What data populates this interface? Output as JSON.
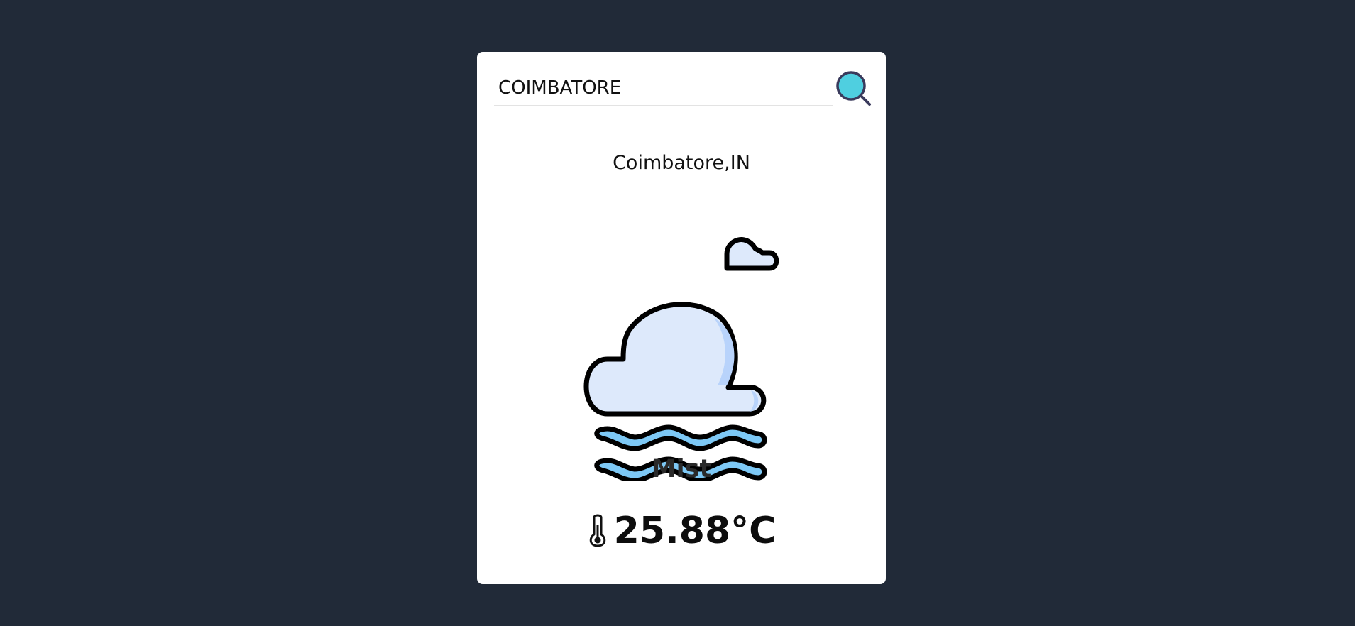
{
  "search": {
    "value": "COIMBATORE",
    "button_icon": "search-icon"
  },
  "weather": {
    "location": "Coimbatore,IN",
    "condition": "Mist",
    "condition_icon": "mist-cloud-icon",
    "temperature": "25.88°C",
    "temperature_icon": "thermometer-icon"
  },
  "colors": {
    "background": "#212a38",
    "card": "#ffffff",
    "cloud_fill": "#dde9fb",
    "cloud_shade": "#b8d3fb",
    "mist_fill": "#7dc8f5",
    "search_lens": "#4fcfe0"
  }
}
